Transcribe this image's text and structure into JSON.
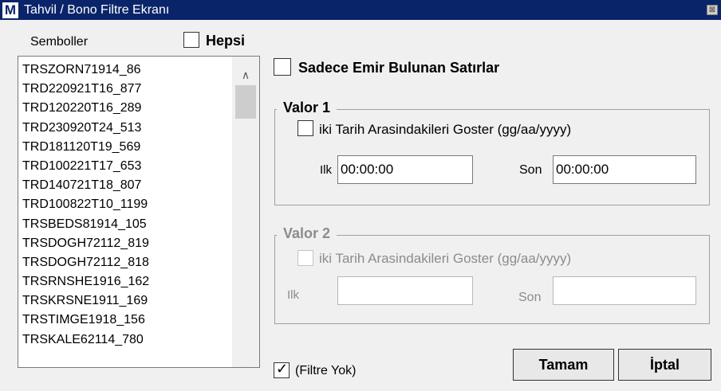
{
  "window": {
    "icon_letter": "M",
    "title": "Tahvil / Bono Filtre Ekranı",
    "close_glyph": "⊠"
  },
  "symbols": {
    "label": "Semboller",
    "all_label": "Hepsi",
    "items": [
      "TRSZORN71914_86",
      "TRD220921T16_877",
      "TRD120220T16_289",
      "TRD230920T24_513",
      "TRD181120T19_569",
      "TRD100221T17_653",
      "TRD140721T18_807",
      "TRD100822T10_1199",
      "TRSBEDS81914_105",
      "TRSDOGH72112_819",
      "TRSDOGH72112_818",
      "TRSRNSHE1916_162",
      "TRSKRSNE1911_169",
      "TRSTIMGE1918_156",
      "TRSKALE62114_780"
    ]
  },
  "only_orders": {
    "label": "Sadece Emir Bulunan Satırlar",
    "checked": false
  },
  "valor1": {
    "title": "Valor 1",
    "range_label": "iki Tarih Arasindakileri Goster (gg/aa/yyyy)",
    "checked": false,
    "start_label": "Ilk",
    "start_value": "00:00:00",
    "end_label": "Son",
    "end_value": "00:00:00"
  },
  "valor2": {
    "title": "Valor 2",
    "range_label": "iki Tarih Arasindakileri Goster (gg/aa/yyyy)",
    "checked": false,
    "start_label": "Ilk",
    "start_value": "",
    "end_label": "Son",
    "end_value": ""
  },
  "no_filter": {
    "label": "(Filtre Yok)",
    "checked": true,
    "tick": "✓"
  },
  "buttons": {
    "ok": "Tamam",
    "cancel": "İptal"
  },
  "scroll_glyphs": {
    "up": "∧",
    "down": "∨"
  }
}
